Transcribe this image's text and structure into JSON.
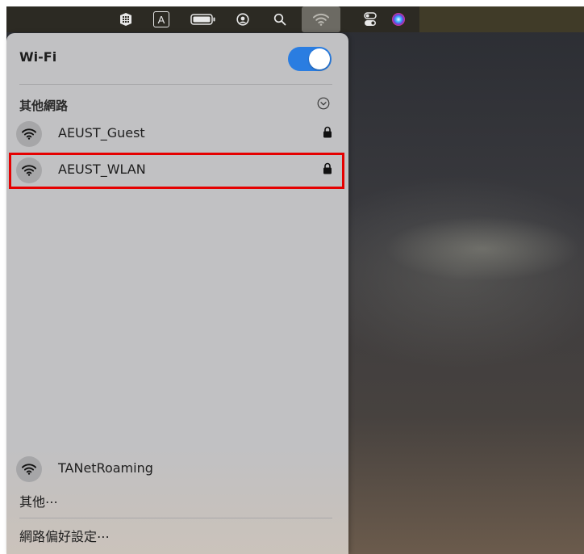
{
  "menubar": {
    "icons": [
      "app-grid-icon",
      "input-source-icon",
      "battery-icon",
      "user-icon",
      "search-icon",
      "wifi-icon",
      "control-center-icon",
      "siri-icon"
    ],
    "input_source_label": "A"
  },
  "wifi_panel": {
    "title": "Wi-Fi",
    "toggle_on": true,
    "section_label": "其他網路",
    "networks": [
      {
        "name": "AEUST_Guest",
        "locked": true
      },
      {
        "name": "AEUST_WLAN",
        "locked": true
      }
    ],
    "known_network": {
      "name": "TANetRoaming"
    },
    "other_label": "其他⋯",
    "preferences_label": "網路偏好設定⋯"
  },
  "colors": {
    "toggle": "#2a7de1",
    "highlight": "#e50000",
    "panel_bg": "#c1c1c3"
  }
}
